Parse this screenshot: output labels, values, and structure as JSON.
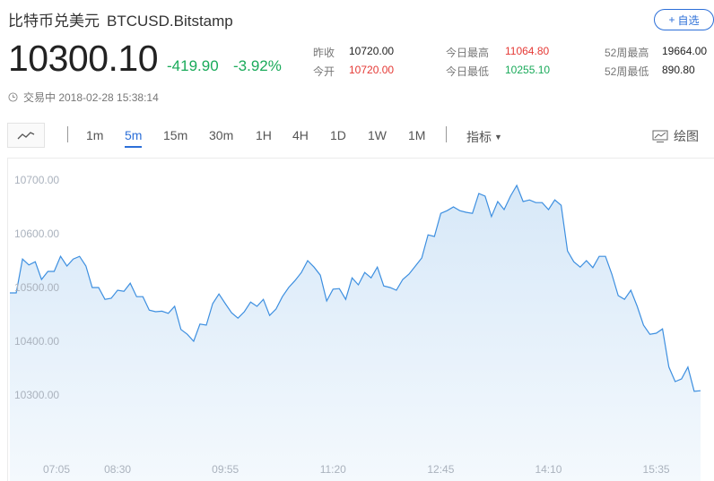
{
  "header": {
    "name": "比特币兑美元",
    "symbol": "BTCUSD.Bitstamp",
    "add_label": "自选",
    "add_icon": "plus-icon"
  },
  "quote": {
    "price": "10300.10",
    "change": "-419.90",
    "change_pct": "-3.92%",
    "status": "交易中 2018-02-28 15:38:14"
  },
  "stats": {
    "prev_close_label": "昨收",
    "prev_close": "10720.00",
    "open_label": "今开",
    "open": "10720.00",
    "high_label": "今日最高",
    "high": "11064.80",
    "low_label": "今日最低",
    "low": "10255.10",
    "wk52_high_label": "52周最高",
    "wk52_high": "19664.00",
    "wk52_low_label": "52周最低",
    "wk52_low": "890.80"
  },
  "toolbar": {
    "timeframes": [
      "1m",
      "5m",
      "15m",
      "30m",
      "1H",
      "4H",
      "1D",
      "1W",
      "1M"
    ],
    "active": "5m",
    "indicator_label": "指标",
    "draw_label": "绘图"
  },
  "colors": {
    "accent": "#2c6fd8",
    "up": "#e53935",
    "down": "#1aaa5a",
    "line": "#3d8fe0"
  },
  "chart_data": {
    "type": "area",
    "ylim": [
      10230,
      10740
    ],
    "y_ticks": [
      10300,
      10400,
      10500,
      10600,
      10700
    ],
    "y_tick_labels": [
      "10300.00",
      "10400.00",
      "10500.00",
      "10600.00",
      "10700.00"
    ],
    "x_tick_labels": [
      "07:05",
      "08:30",
      "09:55",
      "11:20",
      "12:45",
      "14:10",
      "15:35"
    ],
    "x_tick_index": [
      0,
      17,
      34,
      51,
      68,
      85,
      102
    ],
    "values": [
      10490,
      10490,
      10553,
      10542,
      10548,
      10515,
      10530,
      10530,
      10558,
      10540,
      10553,
      10558,
      10540,
      10500,
      10500,
      10478,
      10480,
      10495,
      10493,
      10508,
      10483,
      10483,
      10458,
      10455,
      10456,
      10452,
      10465,
      10422,
      10413,
      10400,
      10432,
      10430,
      10470,
      10488,
      10470,
      10453,
      10443,
      10455,
      10473,
      10465,
      10478,
      10448,
      10460,
      10483,
      10500,
      10513,
      10528,
      10550,
      10538,
      10523,
      10475,
      10497,
      10498,
      10478,
      10518,
      10505,
      10528,
      10518,
      10538,
      10503,
      10500,
      10495,
      10515,
      10525,
      10540,
      10555,
      10598,
      10595,
      10638,
      10643,
      10650,
      10643,
      10640,
      10638,
      10675,
      10670,
      10632,
      10660,
      10645,
      10670,
      10690,
      10660,
      10663,
      10658,
      10658,
      10645,
      10663,
      10653,
      10568,
      10548,
      10538,
      10550,
      10537,
      10558,
      10558,
      10525,
      10485,
      10478,
      10495,
      10465,
      10430,
      10413,
      10415,
      10423,
      10352,
      10325,
      10330,
      10352,
      10307,
      10308
    ]
  }
}
